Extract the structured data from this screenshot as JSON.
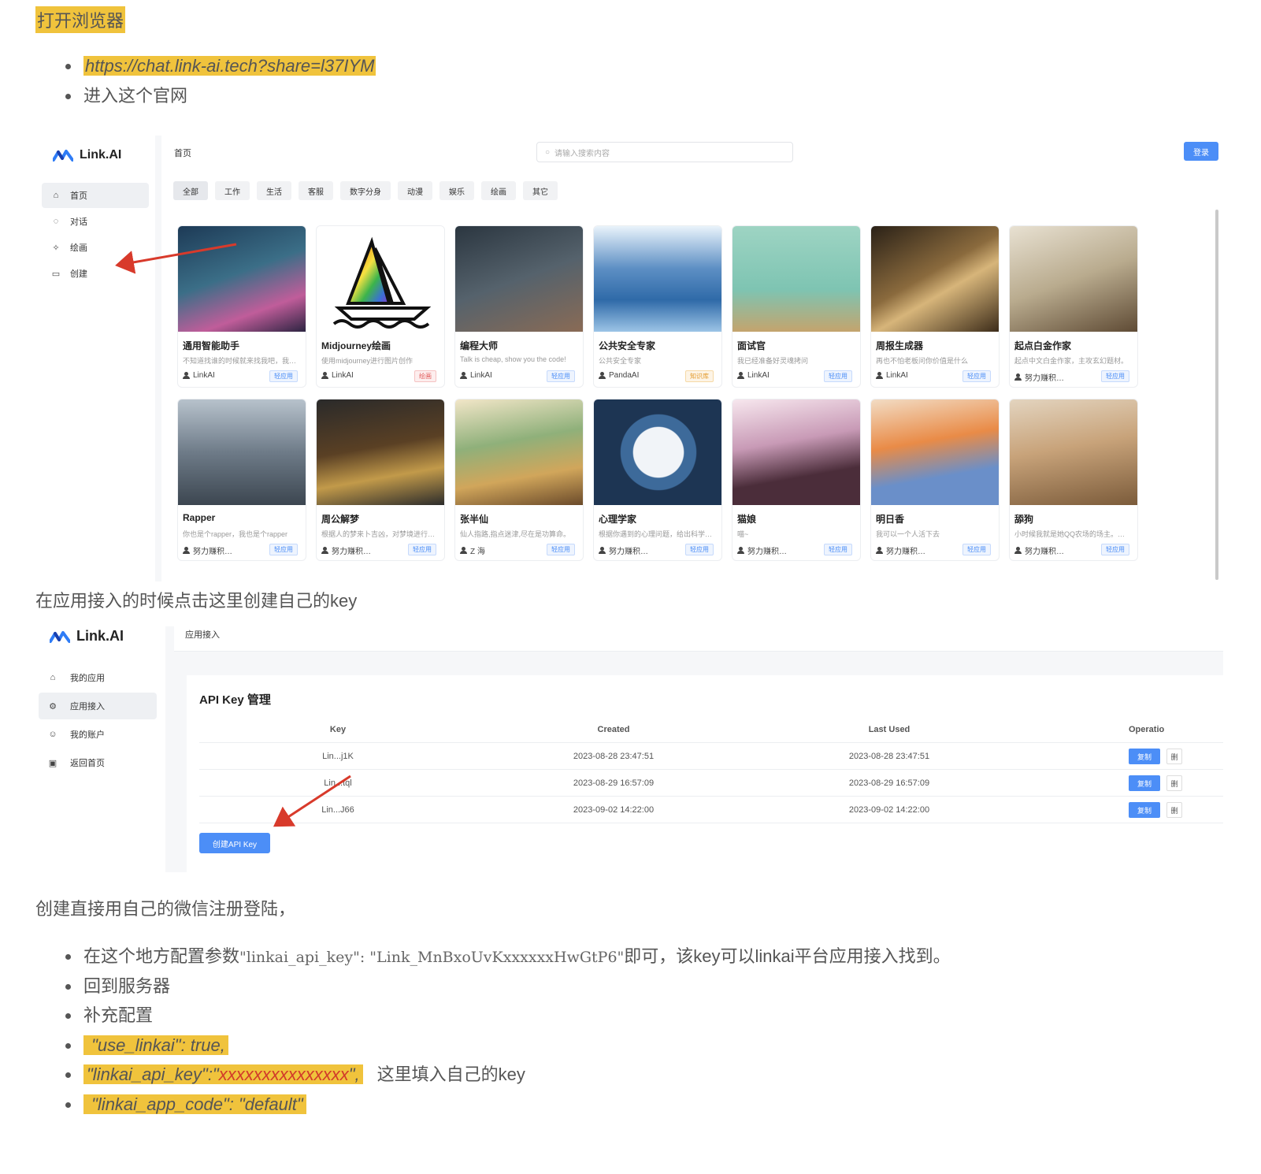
{
  "doc": {
    "heading": "打开浏览器",
    "bullets": [
      "https://chat.link-ai.tech?share=l37IYM",
      "进入这个官网"
    ],
    "para1": "在应用接入的时候点击这里创建自己的key",
    "para2": "创建直接用自己的微信注册登陆，",
    "config": {
      "b1_pre": "在这个地方配置参数",
      "b1_code": "\"linkai_api_key\": \"Link_MnBxoUvKxxxxxxHwGtP6\"",
      "b1_post": "即可，该key可以linkai平台应用接入找到。",
      "b2": "回到服务器",
      "b3": "补充配置",
      "b4": " \"use_linkai\": true,",
      "b5_pre": "\"linkai_api_key\":\"",
      "b5_red": "xxxxxxxxxxxxxxx",
      "b5_post": "\",",
      "b5_note": "这里填入自己的key",
      "b6": " \"linkai_app_code\": \"default\""
    }
  },
  "shot1": {
    "logo": "Link.AI",
    "nav": [
      "首页",
      "对话",
      "绘画",
      "创建"
    ],
    "nav_icons": [
      "home-icon",
      "chat-icon",
      "paint-icon",
      "create-icon"
    ],
    "breadcrumb": "首页",
    "search_placeholder": "请输入搜索内容",
    "login": "登录",
    "tabs": [
      "全部",
      "工作",
      "生活",
      "客服",
      "数字分身",
      "动漫",
      "娱乐",
      "绘画",
      "其它"
    ],
    "cards": [
      {
        "title": "通用智能助手",
        "desc": "不知道找谁的时候就来找我吧，我…",
        "author": "LinkAI",
        "tag": "轻应用",
        "tag_color": "blue"
      },
      {
        "title": "Midjourney绘画",
        "desc": "使用midjourney进行图片创作",
        "author": "LinkAI",
        "tag": "绘画",
        "tag_color": "red"
      },
      {
        "title": "编程大师",
        "desc": "Talk is cheap, show you the code!",
        "author": "LinkAI",
        "tag": "轻应用",
        "tag_color": "blue"
      },
      {
        "title": "公共安全专家",
        "desc": "公共安全专家",
        "author": "PandaAI",
        "tag": "知识库",
        "tag_color": "orange"
      },
      {
        "title": "面试官",
        "desc": "我已经准备好灵魂拷问",
        "author": "LinkAI",
        "tag": "轻应用",
        "tag_color": "blue"
      },
      {
        "title": "周报生成器",
        "desc": "再也不怕老板问你价值是什么",
        "author": "LinkAI",
        "tag": "轻应用",
        "tag_color": "blue"
      },
      {
        "title": "起点白金作家",
        "desc": "起点中文白金作家，主攻玄幻题材。",
        "author": "努力赚积…",
        "tag": "轻应用",
        "tag_color": "blue"
      },
      {
        "title": "Rapper",
        "desc": "你也是个rapper，我也是个rapper",
        "author": "努力赚积…",
        "tag": "轻应用",
        "tag_color": "blue"
      },
      {
        "title": "周公解梦",
        "desc": "根据人的梦来卜吉凶，对梦境进行…",
        "author": "努力赚积…",
        "tag": "轻应用",
        "tag_color": "blue"
      },
      {
        "title": "张半仙",
        "desc": "仙人指路,指点迷津,尽在是功算命。",
        "author": "Z 海",
        "tag": "轻应用",
        "tag_color": "blue"
      },
      {
        "title": "心理学家",
        "desc": "根据你遇到的心理问题，给出科学…",
        "author": "努力赚积…",
        "tag": "轻应用",
        "tag_color": "blue"
      },
      {
        "title": "猫娘",
        "desc": "喵~",
        "author": "努力赚积…",
        "tag": "轻应用",
        "tag_color": "blue"
      },
      {
        "title": "明日香",
        "desc": "我可以一个人活下去",
        "author": "努力赚积…",
        "tag": "轻应用",
        "tag_color": "blue"
      },
      {
        "title": "舔狗",
        "desc": "小时候我就是她QQ农场的场主。…",
        "author": "努力赚积…",
        "tag": "轻应用",
        "tag_color": "blue"
      }
    ]
  },
  "shot2": {
    "logo": "Link.AI",
    "nav": [
      "我的应用",
      "应用接入",
      "我的账户",
      "返回首页"
    ],
    "nav_icons": [
      "home-icon",
      "settings-icon",
      "user-icon",
      "shop-icon"
    ],
    "breadcrumb": "应用接入",
    "title": "API Key 管理",
    "headers": {
      "key": "Key",
      "created": "Created",
      "last_used": "Last Used",
      "operation": "Operatio"
    },
    "rows": [
      {
        "key": "Lin...j1K",
        "created": "2023-08-28 23:47:51",
        "last_used": "2023-08-28 23:47:51"
      },
      {
        "key": "Lin...tql",
        "created": "2023-08-29 16:57:09",
        "last_used": "2023-08-29 16:57:09"
      },
      {
        "key": "Lin...J66",
        "created": "2023-09-02 14:22:00",
        "last_used": "2023-09-02 14:22:00"
      }
    ],
    "copy_label": "复制",
    "delete_label": "删",
    "create_button": "创建API Key"
  },
  "colors": {
    "highlight": "#f0c33c",
    "accent": "#4c8ef7",
    "arrow": "#d83a2b"
  }
}
